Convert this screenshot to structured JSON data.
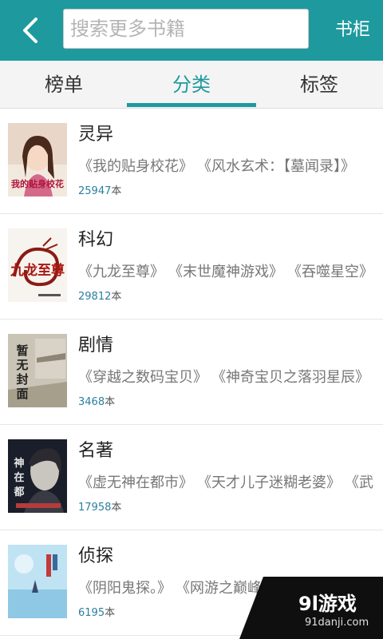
{
  "header": {
    "search_placeholder": "搜索更多书籍",
    "shelf_label": "书柜"
  },
  "tabs": [
    {
      "label": "榜单"
    },
    {
      "label": "分类"
    },
    {
      "label": "标签"
    }
  ],
  "active_tab": "分类",
  "categories": [
    {
      "name": "灵异",
      "books": [
        "《我的贴身校花》",
        "《风水玄术：【墓闻录】》"
      ],
      "count": "25947",
      "unit": "本"
    },
    {
      "name": "科幻",
      "books": [
        "《九龙至尊》",
        "《末世魔神游戏》",
        "《吞噬星空》"
      ],
      "count": "29812",
      "unit": "本"
    },
    {
      "name": "剧情",
      "books": [
        "《穿越之数码宝贝》",
        "《神奇宝贝之落羽星辰》"
      ],
      "count": "3468",
      "unit": "本"
    },
    {
      "name": "名著",
      "books": [
        "《虚无神在都市》",
        "《天才儿子迷糊老婆》",
        "《武"
      ],
      "count": "17958",
      "unit": "本"
    },
    {
      "name": "侦探",
      "books": [
        "《阴阳鬼探。》",
        "《网游之巅峰召唤【完结】》"
      ],
      "count": "6195",
      "unit": "本"
    }
  ],
  "covers": {
    "cover_0": {
      "text": "我的贴身校花"
    },
    "cover_1": {
      "text": "九龙至尊"
    },
    "cover_2": {
      "text": "暂无封面"
    },
    "cover_3": {
      "text": "神在都市"
    },
    "cover_4": {
      "text": ""
    }
  },
  "watermark": {
    "title": "9l游戏",
    "subtitle": "91danji.com"
  },
  "colors": {
    "accent": "#1e9a9e",
    "count": "#2a7fa0"
  }
}
